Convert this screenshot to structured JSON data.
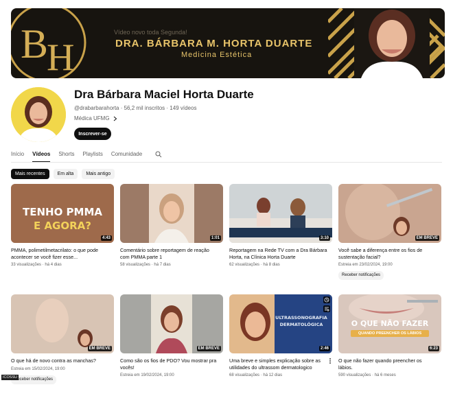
{
  "banner": {
    "announce": "Vídeo novo toda Segunda!",
    "name": "DRA. BÁRBARA M. HORTA DUARTE",
    "specialty": "Medicina Estética",
    "logo_text": "BH"
  },
  "channel": {
    "title": "Dra Bárbara Maciel Horta Duarte",
    "handle": "@drabarbarahorta",
    "subscribers": "56,2 mil inscritos",
    "videos_count": "149 vídeos",
    "about": "Médica UFMG",
    "subscribe_label": "Inscrever-se"
  },
  "tabs": [
    {
      "label": "Início"
    },
    {
      "label": "Vídeos"
    },
    {
      "label": "Shorts"
    },
    {
      "label": "Playlists"
    },
    {
      "label": "Comunidade"
    }
  ],
  "chips": [
    {
      "label": "Mais recentes"
    },
    {
      "label": "Em alta"
    },
    {
      "label": "Mais antigo"
    }
  ],
  "videos": [
    {
      "thumb_text_1": "TENHO PMMA",
      "thumb_text_2": "E AGORA?",
      "badge": "4:43",
      "title": "PMMA, polimetilmetacrilato: o que pode acontecer se você fizer esse...",
      "views": "33 visualizações",
      "age": "há 4 dias"
    },
    {
      "badge": "1:01",
      "title": "Comentário sobre reportagem de reação com PMMA parte 1",
      "views": "58 visualizações",
      "age": "há 7 dias"
    },
    {
      "badge": "3:10",
      "title": "Reportagem na Rede TV com a Dra Bárbara Horta, na Clínica Horta Duarte",
      "views": "62 visualizações",
      "age": "há 8 dias"
    },
    {
      "badge": "EM BREVE",
      "title": "Você sabe a diferença entre os fios de sustentação facial?",
      "premiere": "Estreia em 23/02/2024, 19:00",
      "notify_label": "Receber notificações"
    },
    {
      "badge": "EM BREVE",
      "title": "O que há de novo contra as manchas?",
      "premiere": "Estreia em 15/02/2024, 19:00",
      "notify_label": "Receber notificações"
    },
    {
      "badge": "EM BREVE",
      "title": "Como são os fios de PDO? Vou mostrar pra vocês!",
      "premiere": "Estreia em 19/02/2024, 19:00"
    },
    {
      "thumb_text_1": "ULTRASSONOGRAFIA",
      "thumb_text_2": "DERMATOLÓGICA",
      "badge": "2:46",
      "title": "Uma breve e simples explicação sobre as utilidades do ultrassom dermatologico",
      "views": "68 visualizações",
      "age": "há 12 dias"
    },
    {
      "thumb_text_1": "O QUE NÃO FAZER",
      "thumb_text_2": "QUANDO PREENCHER OS LÁBIOS",
      "badge": "6:23",
      "title": "O que não fazer quando preencher os lábios.",
      "views": "590 visualizações",
      "age": "há 6 meses"
    }
  ],
  "tooltip": "ICOSSU",
  "colors": {
    "gold": "#e8c46a",
    "banner_bg": "#17140f",
    "avatar_bg": "#f1d74a",
    "accent_dark": "#0f0f0f"
  },
  "icons": {
    "chevron": "chevron-right-icon",
    "search": "search-icon",
    "kebab": "more-vert-icon",
    "clock": "watch-later-icon",
    "queue": "add-to-queue-icon"
  }
}
